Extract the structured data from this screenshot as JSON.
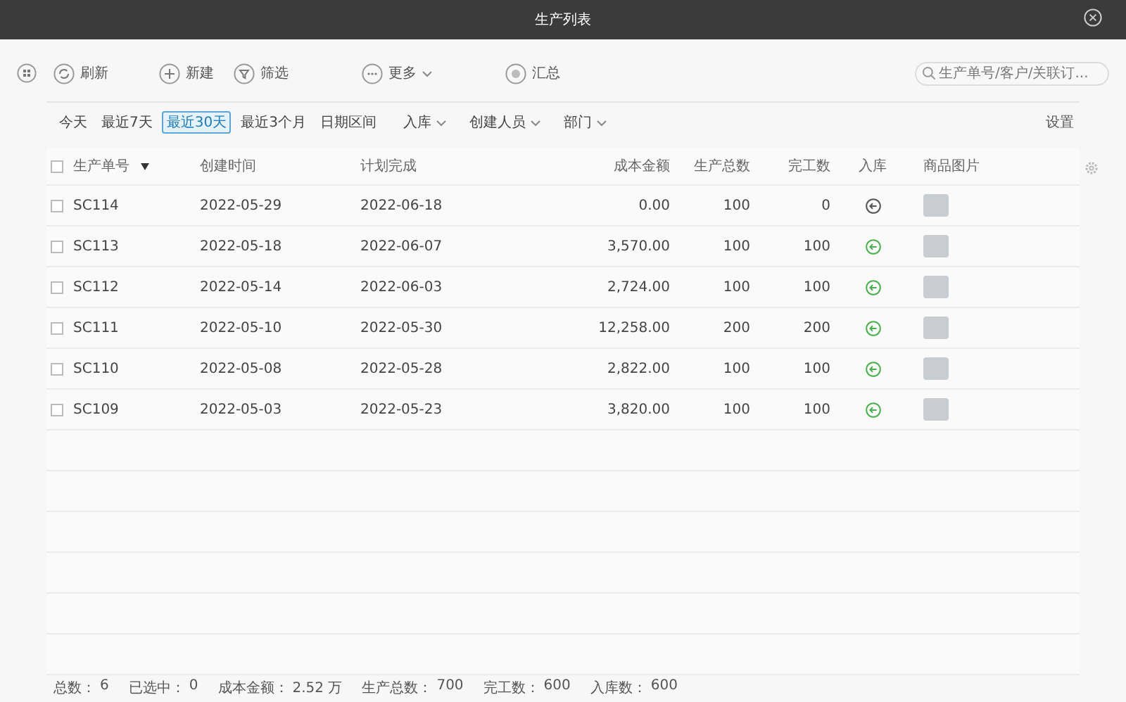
{
  "window": {
    "title": "生产列表"
  },
  "toolbar": {
    "buttons": [
      {
        "kind": "refresh",
        "label": "刷新"
      },
      {
        "kind": "new",
        "label": "新建"
      },
      {
        "kind": "filter",
        "label": "筛选"
      },
      {
        "kind": "more",
        "label": "更多"
      },
      {
        "kind": "summary",
        "label": "汇总"
      }
    ],
    "search": {
      "placeholder": "生产单号/客户/关联订..."
    }
  },
  "date_filters": [
    {
      "label": "今天",
      "selected": false
    },
    {
      "label": "最近7天",
      "selected": false
    },
    {
      "label": "最近30天",
      "selected": true
    },
    {
      "label": "最近3个月",
      "selected": false
    },
    {
      "label": "日期区间",
      "selected": false
    }
  ],
  "dropdown_filters": [
    "入库",
    "创建人员",
    "部门"
  ],
  "settings_link": "设置",
  "table": {
    "all_checked": false,
    "columns": [
      "生产单号",
      "创建时间",
      "计划完成",
      "成本金额",
      "生产总数",
      "完工数",
      "入库",
      "商品图片"
    ],
    "rows": [
      {
        "id": "SC114",
        "created": "2022-05-29",
        "planned": "2022-06-18",
        "cost": "0.00",
        "total": "100",
        "done": "0",
        "stocked": false,
        "checked": false
      },
      {
        "id": "SC113",
        "created": "2022-05-18",
        "planned": "2022-06-07",
        "cost": "3,570.00",
        "total": "100",
        "done": "100",
        "stocked": true,
        "checked": false
      },
      {
        "id": "SC112",
        "created": "2022-05-14",
        "planned": "2022-06-03",
        "cost": "2,724.00",
        "total": "100",
        "done": "100",
        "stocked": true,
        "checked": false
      },
      {
        "id": "SC111",
        "created": "2022-05-10",
        "planned": "2022-05-30",
        "cost": "12,258.00",
        "total": "200",
        "done": "200",
        "stocked": true,
        "checked": false
      },
      {
        "id": "SC110",
        "created": "2022-05-08",
        "planned": "2022-05-28",
        "cost": "2,822.00",
        "total": "100",
        "done": "100",
        "stocked": true,
        "checked": false
      },
      {
        "id": "SC109",
        "created": "2022-05-03",
        "planned": "2022-05-23",
        "cost": "3,820.00",
        "total": "100",
        "done": "100",
        "stocked": true,
        "checked": false
      }
    ]
  },
  "status_bar": [
    {
      "label": "总数：",
      "value": "6"
    },
    {
      "label": "已选中：",
      "value": "0"
    },
    {
      "label": "成本金额：",
      "value": "2.52 万"
    },
    {
      "label": "生产总数：",
      "value": "700"
    },
    {
      "label": "完工数：",
      "value": "600"
    },
    {
      "label": "入库数：",
      "value": "600"
    }
  ]
}
